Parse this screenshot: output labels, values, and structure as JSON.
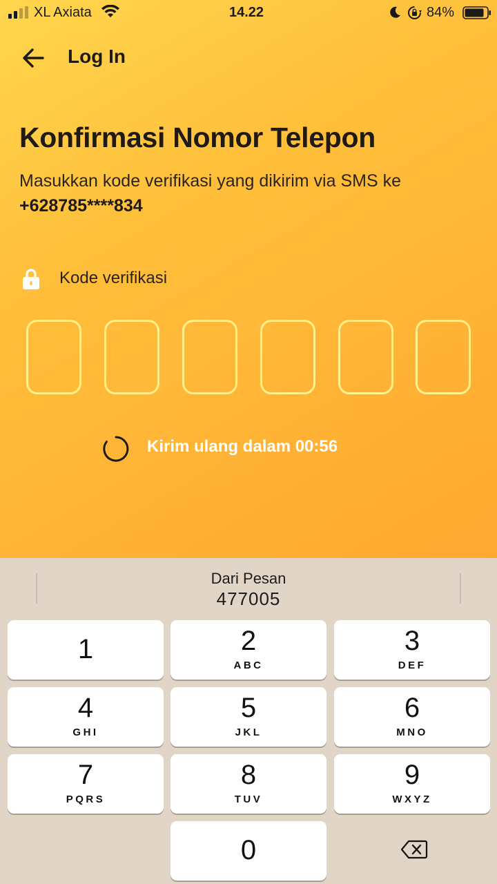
{
  "status_bar": {
    "carrier": "XL Axiata",
    "time": "14.22",
    "battery": "84%",
    "icons": [
      "signal-icon",
      "wifi-icon",
      "moon-icon",
      "rotation-lock-icon",
      "battery-icon"
    ]
  },
  "header": {
    "back_icon": "arrow-left-icon",
    "title": "Log In"
  },
  "content": {
    "title": "Konfirmasi Nomor Telepon",
    "subtitle": "Masukkan kode verifikasi yang dikirim via SMS ke",
    "phone": "+628785****834",
    "code_label": "Kode verifikasi",
    "code_icon": "lock-icon",
    "otp_boxes": [
      "",
      "",
      "",
      "",
      "",
      ""
    ],
    "resend_text": "Kirim ulang dalam 00:56"
  },
  "keyboard": {
    "suggestion_source": "Dari Pesan",
    "suggestion_code": "477005",
    "keys": [
      {
        "num": "1",
        "letters": ""
      },
      {
        "num": "2",
        "letters": "ABC"
      },
      {
        "num": "3",
        "letters": "DEF"
      },
      {
        "num": "4",
        "letters": "GHI"
      },
      {
        "num": "5",
        "letters": "JKL"
      },
      {
        "num": "6",
        "letters": "MNO"
      },
      {
        "num": "7",
        "letters": "PQRS"
      },
      {
        "num": "8",
        "letters": "TUV"
      },
      {
        "num": "9",
        "letters": "WXYZ"
      },
      {
        "num": "0",
        "letters": ""
      }
    ],
    "delete_icon": "backspace-icon"
  },
  "colors": {
    "background_top": "#ffd64d",
    "background_bottom": "#ffa931",
    "otp_border": "#fff08a",
    "keyboard_bg": "#e1d5c8"
  }
}
